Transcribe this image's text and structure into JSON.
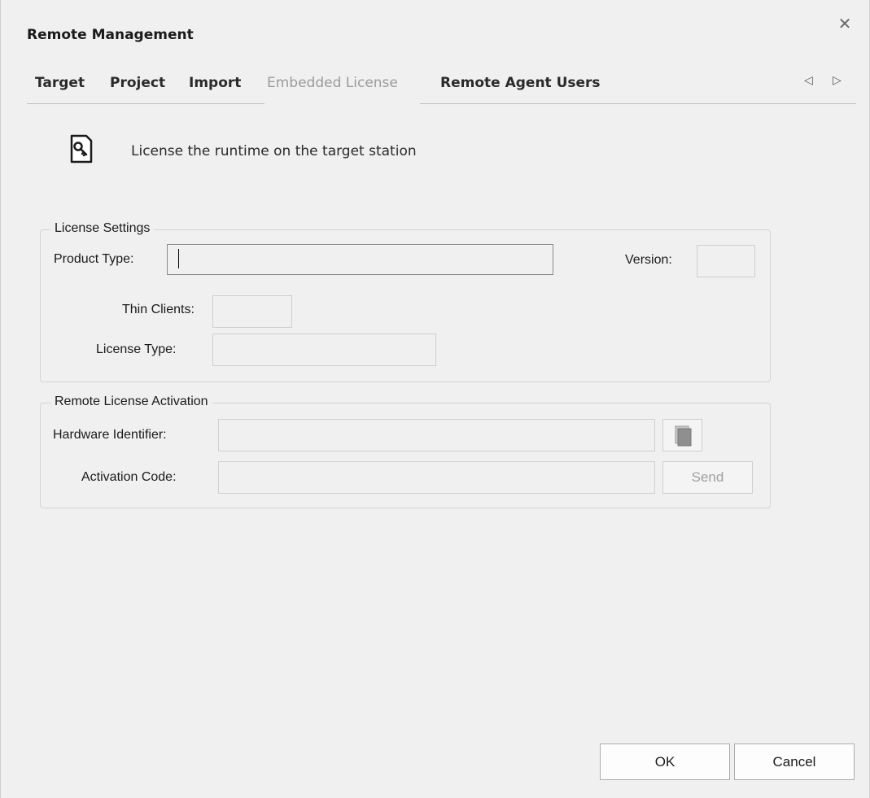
{
  "window": {
    "title": "Remote Management",
    "close_glyph": "✕"
  },
  "tabs": [
    {
      "label": "Target"
    },
    {
      "label": "Project"
    },
    {
      "label": "Import"
    },
    {
      "label": "Embedded License",
      "active": true
    },
    {
      "label": "Remote Agent Users"
    }
  ],
  "tab_scroll": {
    "left_glyph": "◁",
    "right_glyph": "▷"
  },
  "header": {
    "icon": "license-key-icon",
    "text": "License the runtime on the target station"
  },
  "license_settings": {
    "group_label": "License Settings",
    "product_type_label": "Product Type:",
    "product_type_value": "",
    "version_label": "Version:",
    "version_value": "",
    "thin_clients_label": "Thin Clients:",
    "thin_clients_value": "",
    "license_type_label": "License Type:",
    "license_type_value": ""
  },
  "remote_activation": {
    "group_label": "Remote License Activation",
    "hardware_id_label": "Hardware Identifier:",
    "hardware_id_value": "",
    "copy_icon": "copy-icon",
    "activation_code_label": "Activation Code:",
    "activation_code_value": "",
    "send_label": "Send"
  },
  "footer": {
    "ok_label": "OK",
    "cancel_label": "Cancel"
  }
}
